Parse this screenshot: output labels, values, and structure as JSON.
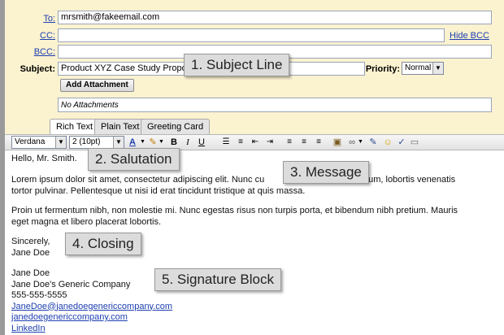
{
  "header": {
    "to_label": "To:",
    "to_value": "mrsmith@fakeemail.com",
    "cc_label": "CC:",
    "bcc_label": "BCC:",
    "hide_bcc": "Hide BCC",
    "subject_label": "Subject:",
    "subject_value": "Product XYZ Case Study Proposal",
    "priority_label": "Priority:",
    "priority_value": "Normal",
    "add_attachment": "Add Attachment",
    "no_attachments": "No Attachments"
  },
  "tabs": [
    {
      "label": "Rich Text"
    },
    {
      "label": "Plain Text"
    },
    {
      "label": "Greeting Card"
    }
  ],
  "toolbar": {
    "font": "Verdana",
    "size": "2 (10pt)",
    "bold": "B",
    "italic": "I",
    "underline": "U"
  },
  "message": {
    "greeting": "Hello, Mr. Smith.",
    "para1": "Lorem ipsum dolor sit amet, consectetur adipiscing elit. Nunc cu... ...erdum, lobortis venenatis tortor pulvinar. Pellentesque ut nisi id erat tincidunt tristique at quis massa.",
    "para1_a": "Lorem ipsum dolor sit amet, consectetur adipiscing elit. Nunc cu",
    "para1_b": "erdum, lobortis venenatis",
    "para1_c": "tortor pulvinar. Pellentesque ut nisi id erat tincidunt tristique at quis massa.",
    "para2_a": "Proin ut fermentum nibh, non molestie mi. Nunc egestas risus non turpis porta, et bibendum nibh pretium. Mauris",
    "para2_b": "eget magna et libero placerat lobortis.",
    "closing": "Sincerely,",
    "closing_name": "Jane Doe",
    "sig_name": "Jane Doe",
    "sig_company": "Jane Doe's Generic Company",
    "sig_phone": "555-555-5555",
    "sig_email": "JaneDoe@janedoegenericcompany.com",
    "sig_site": "janedoegenericcompany.com",
    "sig_linkedin": "LinkedIn"
  },
  "callouts": {
    "c1": "1. Subject Line",
    "c2": "2. Salutation",
    "c3": "3. Message",
    "c4": "4. Closing",
    "c5": "5. Signature Block"
  }
}
